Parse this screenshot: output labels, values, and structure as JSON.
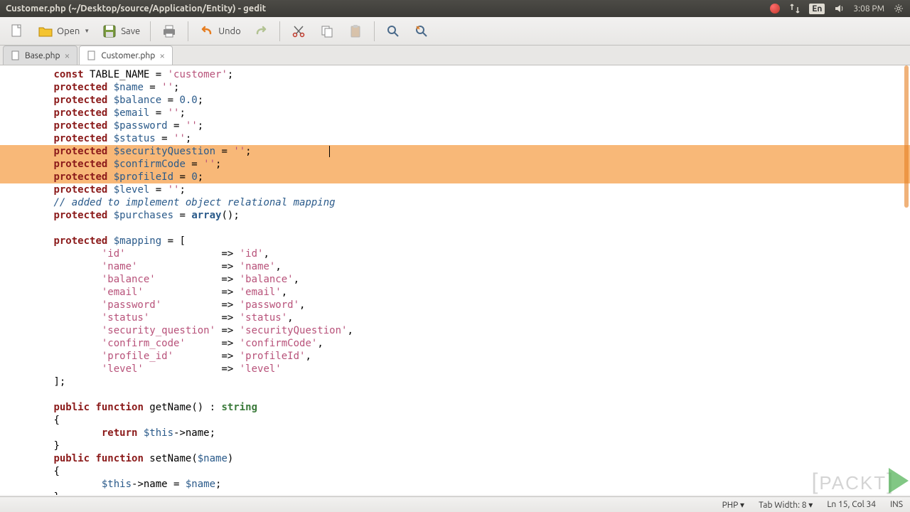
{
  "menubar": {
    "title": "Customer.php (~/Desktop/source/Application/Entity) - gedit",
    "lang": "En",
    "time": "3:08 PM"
  },
  "toolbar": {
    "open": "Open",
    "save": "Save",
    "undo": "Undo"
  },
  "tabs": [
    {
      "label": "Base.php",
      "active": false
    },
    {
      "label": "Customer.php",
      "active": true
    }
  ],
  "code": {
    "l1_1": "const",
    "l1_2": " TABLE_NAME = ",
    "l1_3": "'customer'",
    "l1_4": ";",
    "l2_1": "protected",
    "l2_2": " $name",
    "l2_3": " = ",
    "l2_4": "''",
    "l2_5": ";",
    "l3_1": "protected",
    "l3_2": " $balance",
    "l3_3": " = ",
    "l3_4": "0.0",
    "l3_5": ";",
    "l4_1": "protected",
    "l4_2": " $email",
    "l4_3": " = ",
    "l4_4": "''",
    "l4_5": ";",
    "l5_1": "protected",
    "l5_2": " $password",
    "l5_3": " = ",
    "l5_4": "''",
    "l5_5": ";",
    "l6_1": "protected",
    "l6_2": " $status",
    "l6_3": " = ",
    "l6_4": "''",
    "l6_5": ";",
    "l7_1": "protected",
    "l7_2": " $securityQuestion",
    "l7_3": " = ",
    "l7_4": "''",
    "l7_5": ";",
    "l8_1": "protected",
    "l8_2": " $confirmCode",
    "l8_3": " = ",
    "l8_4": "''",
    "l8_5": ";",
    "l9_1": "protected",
    "l9_2": " $profileId",
    "l9_3": " = ",
    "l9_4": "0",
    "l9_5": ";",
    "l10_1": "protected",
    "l10_2": " $level",
    "l10_3": " = ",
    "l10_4": "''",
    "l10_5": ";",
    "l11": "// added to implement object relational mapping",
    "l12_1": "protected",
    "l12_2": " $purchases",
    "l12_3": " = ",
    "l12_4": "array",
    "l12_5": "();",
    "l14_1": "protected",
    "l14_2": " $mapping",
    "l14_3": " = [",
    "m1_1": "'id'",
    "m1_2": "                => ",
    "m1_3": "'id'",
    "m1_4": ",",
    "m2_1": "'name'",
    "m2_2": "              => ",
    "m2_3": "'name'",
    "m2_4": ",",
    "m3_1": "'balance'",
    "m3_2": "           => ",
    "m3_3": "'balance'",
    "m3_4": ",",
    "m4_1": "'email'",
    "m4_2": "             => ",
    "m4_3": "'email'",
    "m4_4": ",",
    "m5_1": "'password'",
    "m5_2": "          => ",
    "m5_3": "'password'",
    "m5_4": ",",
    "m6_1": "'status'",
    "m6_2": "            => ",
    "m6_3": "'status'",
    "m6_4": ",",
    "m7_1": "'security_question'",
    "m7_2": " => ",
    "m7_3": "'securityQuestion'",
    "m7_4": ",",
    "m8_1": "'confirm_code'",
    "m8_2": "      => ",
    "m8_3": "'confirmCode'",
    "m8_4": ",",
    "m9_1": "'profile_id'",
    "m9_2": "        => ",
    "m9_3": "'profileId'",
    "m9_4": ",",
    "m10_1": "'level'",
    "m10_2": "             => ",
    "m10_3": "'level'",
    "l25": "];",
    "f1_1": "public",
    "f1_2": " function",
    "f1_3": " getName",
    "f1_4": "() : ",
    "f1_5": "string",
    "f2": "{",
    "f3_1": "return",
    "f3_2": " $this",
    "f3_3": "->name;",
    "f4": "}",
    "f5_1": "public",
    "f5_2": " function",
    "f5_3": " setName",
    "f5_4": "(",
    "f5_5": "$name",
    "f5_6": ")",
    "f6": "{",
    "f7_1": "$this",
    "f7_2": "->name = ",
    "f7_3": "$name",
    "f7_4": ";",
    "f8": "}"
  },
  "statusbar": {
    "lang": "PHP",
    "tab": "Tab Width: 8",
    "pos": "Ln 15, Col 34",
    "ins": "INS"
  },
  "watermark": {
    "text1": "PACKT"
  }
}
